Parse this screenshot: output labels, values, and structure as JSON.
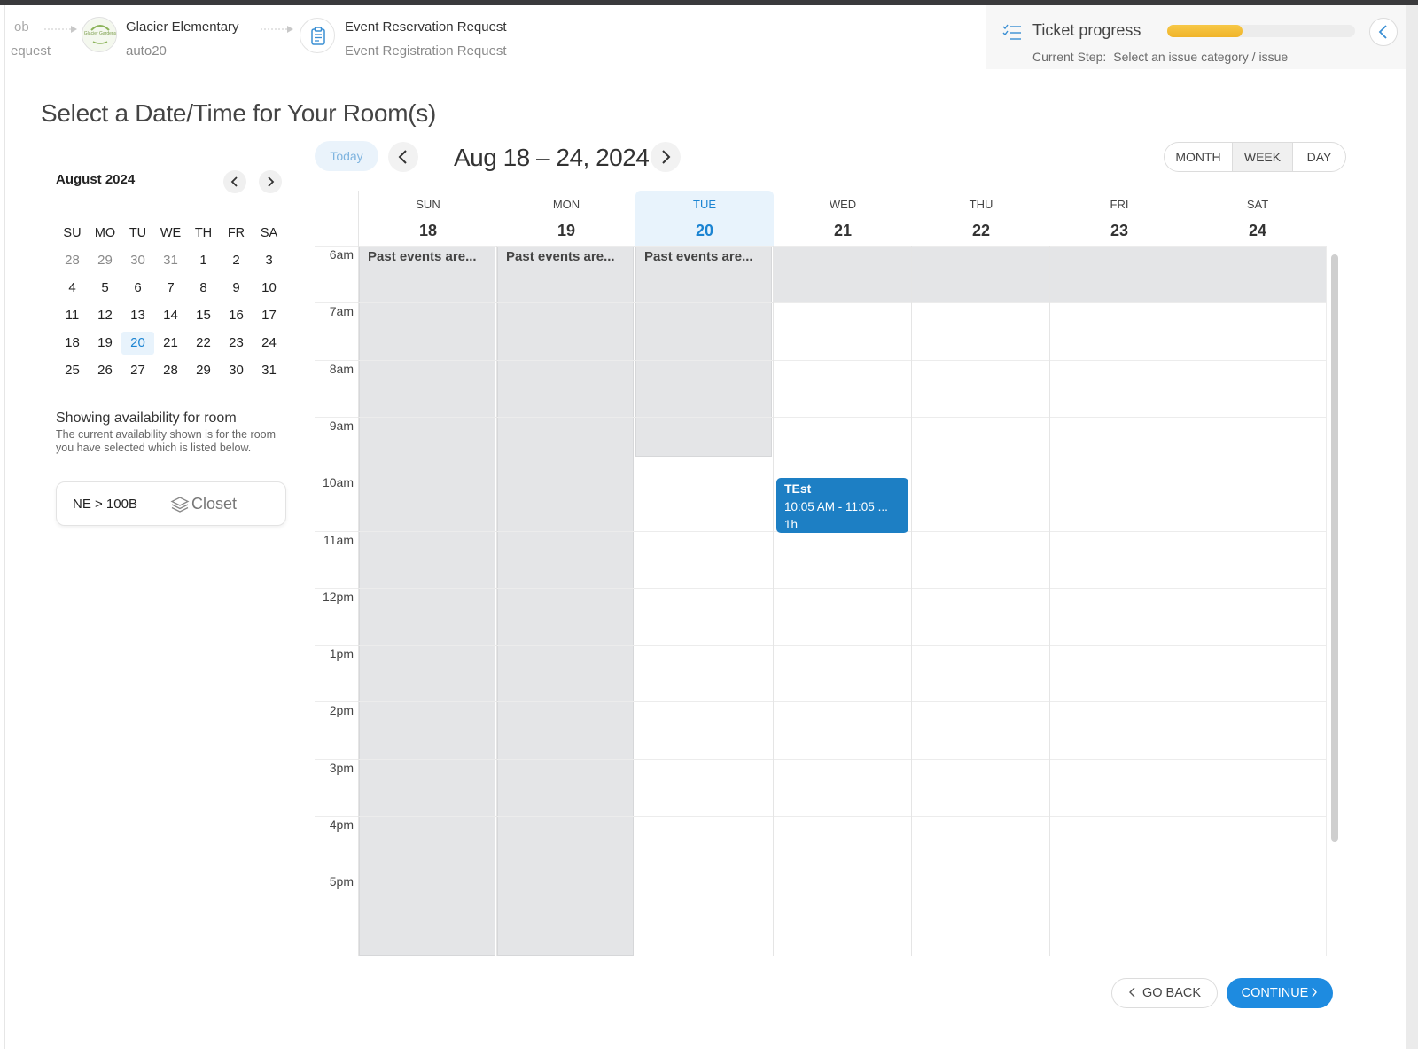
{
  "breadcrumbs": [
    {
      "title": "ob",
      "subtitle": "equest"
    },
    {
      "title": "Glacier Elementary",
      "subtitle": "auto20",
      "logo_text": "Glacier Gardens"
    },
    {
      "title": "Event Reservation Request",
      "subtitle": "Event Registration Request"
    }
  ],
  "progress": {
    "title": "Ticket progress",
    "fraction": 0.4,
    "step_label": "Current Step:",
    "step_value": "Select an issue category / issue"
  },
  "page_title": "Select a Date/Time for Your Room(s)",
  "mini_calendar": {
    "month_label": "August 2024",
    "weekdays": [
      "SU",
      "MO",
      "TU",
      "WE",
      "TH",
      "FR",
      "SA"
    ],
    "weeks": [
      [
        "28",
        "29",
        "30",
        "31",
        "1",
        "2",
        "3"
      ],
      [
        "4",
        "5",
        "6",
        "7",
        "8",
        "9",
        "10"
      ],
      [
        "11",
        "12",
        "13",
        "14",
        "15",
        "16",
        "17"
      ],
      [
        "18",
        "19",
        "20",
        "21",
        "22",
        "23",
        "24"
      ],
      [
        "25",
        "26",
        "27",
        "28",
        "29",
        "30",
        "31"
      ]
    ],
    "selected": "20"
  },
  "availability": {
    "title": "Showing availability for room",
    "description": "The current availability shown is for the room you have selected which is listed below.",
    "room_code": "NE > 100B",
    "room_type": "Closet"
  },
  "toolbar": {
    "today_label": "Today",
    "range_title": "Aug 18 – 24, 2024",
    "views": [
      "MONTH",
      "WEEK",
      "DAY"
    ],
    "active_view": "WEEK"
  },
  "week": {
    "days": [
      {
        "dow": "SUN",
        "num": "18"
      },
      {
        "dow": "MON",
        "num": "19"
      },
      {
        "dow": "TUE",
        "num": "20",
        "today": true
      },
      {
        "dow": "WED",
        "num": "21"
      },
      {
        "dow": "THU",
        "num": "22"
      },
      {
        "dow": "FRI",
        "num": "23"
      },
      {
        "dow": "SAT",
        "num": "24"
      }
    ],
    "hours": [
      "6am",
      "7am",
      "8am",
      "9am",
      "10am",
      "11am",
      "12pm",
      "1pm",
      "2pm",
      "3pm",
      "4pm",
      "5pm"
    ],
    "past_label": "Past events are...",
    "event": {
      "title": "TEst",
      "time": "10:05 AM - 11:05 ...",
      "duration": "1h"
    }
  },
  "footer": {
    "back_label": "GO BACK",
    "continue_label": "CONTINUE"
  },
  "colors": {
    "accent": "#1e8be0",
    "event": "#1d7fc4",
    "progress": "#f0b429",
    "past": "#e4e5e7"
  }
}
